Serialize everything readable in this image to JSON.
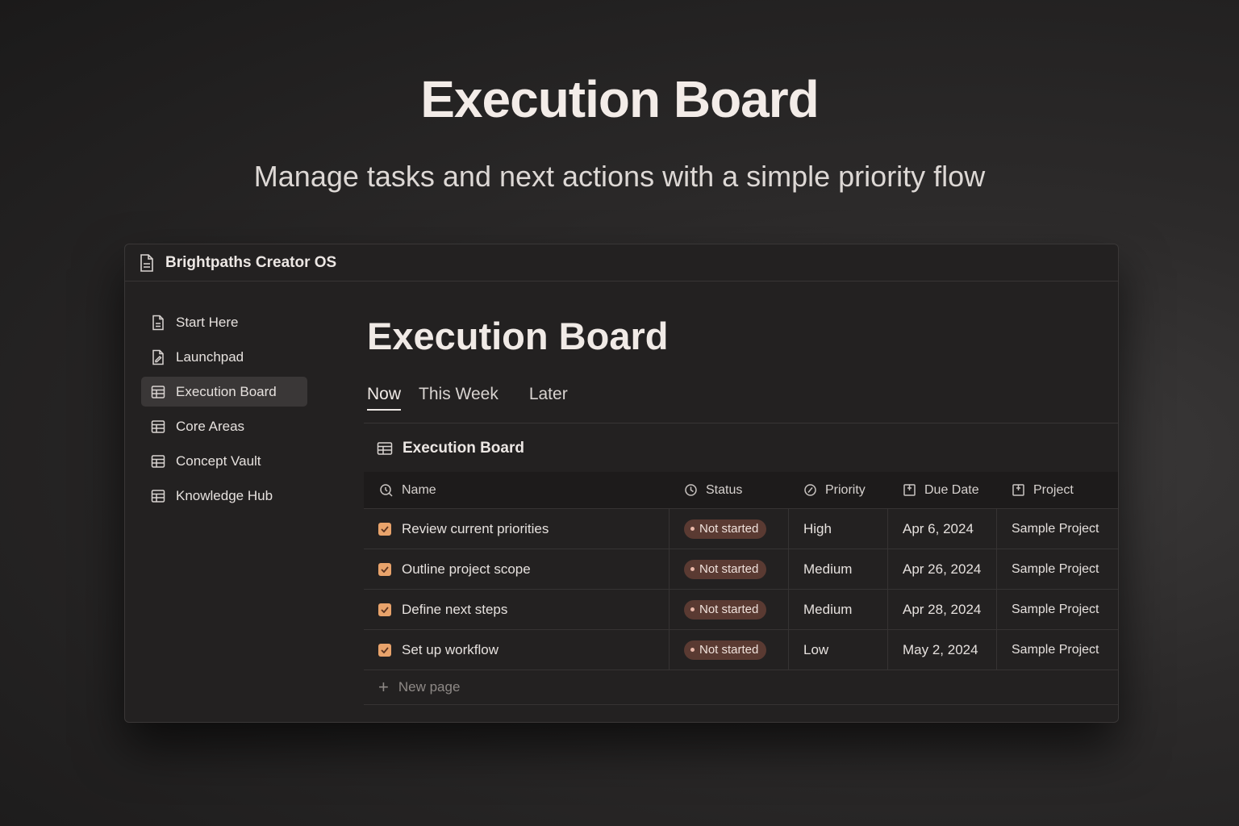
{
  "hero": {
    "title": "Execution Board",
    "subtitle": "Manage tasks and next actions with a simple priority flow"
  },
  "window": {
    "title": "Brightpaths Creator OS",
    "icon": "document-icon"
  },
  "sidebar": {
    "items": [
      {
        "label": "Start Here",
        "icon": "document-icon",
        "active": false
      },
      {
        "label": "Launchpad",
        "icon": "document-edit-icon",
        "active": false
      },
      {
        "label": "Execution Board",
        "icon": "table-icon",
        "active": true
      },
      {
        "label": "Core Areas",
        "icon": "table-icon",
        "active": false
      },
      {
        "label": "Concept Vault",
        "icon": "table-icon",
        "active": false
      },
      {
        "label": "Knowledge Hub",
        "icon": "table-icon",
        "active": false
      }
    ]
  },
  "main": {
    "title": "Execution Board",
    "tabs": [
      {
        "label": "Now",
        "active": true
      },
      {
        "label": "This Week",
        "active": false
      },
      {
        "label": "Later",
        "active": false
      }
    ],
    "database": {
      "title": "Execution Board",
      "columns": {
        "name": "Name",
        "status": "Status",
        "priority": "Priority",
        "due": "Due Date",
        "project": "Project"
      },
      "rows": [
        {
          "name": "Review current priorities",
          "status": "Not started",
          "priority": "High",
          "due": "Apr 6, 2024",
          "project": "Sample Project"
        },
        {
          "name": "Outline project scope",
          "status": "Not started",
          "priority": "Medium",
          "due": "Apr 26, 2024",
          "project": "Sample Project"
        },
        {
          "name": "Define next steps",
          "status": "Not started",
          "priority": "Medium",
          "due": "Apr 28, 2024",
          "project": "Sample Project"
        },
        {
          "name": "Set up workflow",
          "status": "Not started",
          "priority": "Low",
          "due": "May 2, 2024",
          "project": "Sample Project"
        }
      ],
      "new_page_label": "New page"
    }
  },
  "colors": {
    "accent_checkbox": "#e8a36b",
    "status_pill_bg": "#5a3a32",
    "window_bg": "#232121",
    "page_bg": "#2c2a2a"
  }
}
